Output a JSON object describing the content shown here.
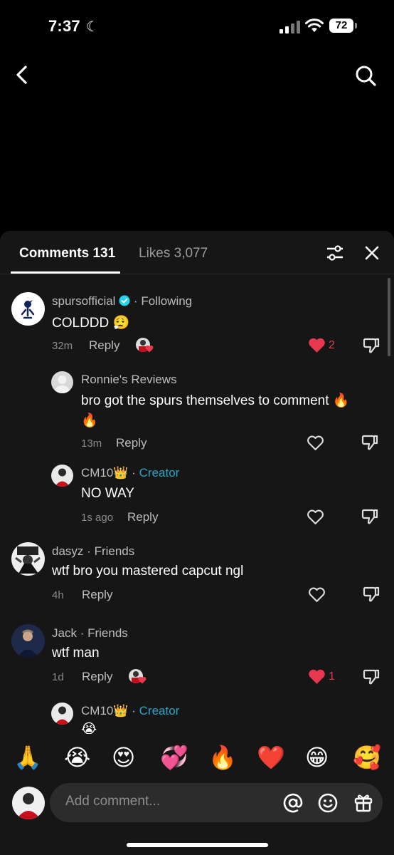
{
  "status": {
    "time": "7:37",
    "battery": "72"
  },
  "tabs": {
    "comments": "Comments 131",
    "likes": "Likes 3,077"
  },
  "comments": [
    {
      "user": "spursofficial",
      "verified": true,
      "tag": "Following",
      "text": "COLDDD 😮‍💨",
      "time": "32m",
      "reply": "Reply",
      "likes": "2",
      "liked": true,
      "replies": [
        {
          "user": "Ronnie's Reviews",
          "text1": "bro got the spurs themselves to comment 🔥",
          "text2": "🔥",
          "time": "13m",
          "reply": "Reply"
        },
        {
          "user": "CM10👑",
          "tag": "Creator",
          "text": "NO WAY",
          "time": "1s ago",
          "reply": "Reply"
        }
      ]
    },
    {
      "user": "dasyz",
      "tag": "Friends",
      "text": "wtf bro you mastered capcut ngl",
      "time": "4h",
      "reply": "Reply"
    },
    {
      "user": "Jack",
      "tag": "Friends",
      "text": "wtf man",
      "time": "1d",
      "reply": "Reply",
      "likes": "1",
      "liked": true,
      "replies": [
        {
          "user": "CM10👑",
          "tag": "Creator",
          "text": "😭"
        }
      ]
    }
  ],
  "emoji_bar": [
    "🙏",
    "😭",
    "😍",
    "💞",
    "🔥",
    "❤️",
    "😁",
    "🥰"
  ],
  "input": {
    "placeholder": "Add comment..."
  },
  "colors": {
    "accent_like": "#e8384f",
    "creator": "#2aa5c9",
    "sheet_bg": "#161616"
  }
}
